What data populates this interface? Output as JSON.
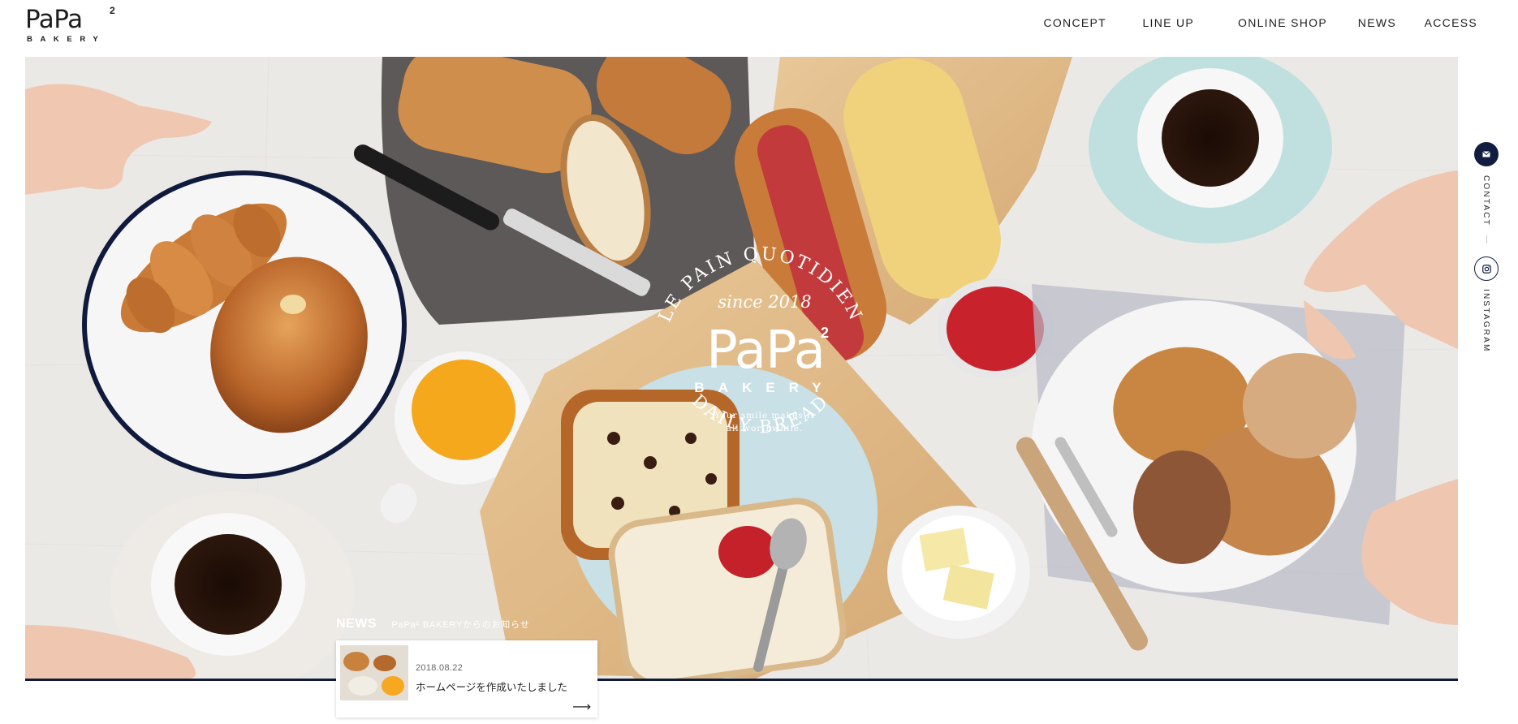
{
  "brand": {
    "logo_word": "PaPa",
    "logo_sup": "2",
    "logo_sub": "BAKERY"
  },
  "nav": {
    "items": [
      {
        "label": "CONCEPT"
      },
      {
        "label": "LINE UP"
      },
      {
        "label": "ONLINE SHOP"
      },
      {
        "label": "NEWS"
      },
      {
        "label": "ACCESS"
      }
    ]
  },
  "hero": {
    "arc_top": "LE PAIN QUOTIDIEN",
    "since": "since 2018",
    "papa": "PaPa",
    "papa_sup": "2",
    "bakery": "BAKERY",
    "tagline_1": "Your smile makes it",
    "tagline_2": "all worthwhile.",
    "arc_bottom": "DAILY BREAD"
  },
  "side": {
    "contact_label": "CONTACT",
    "instagram_label": "INSTAGRAM"
  },
  "news": {
    "heading": "NEWS",
    "subheading": "PaPa² BAKERYからのお知らせ",
    "items": [
      {
        "date": "2018.08.22",
        "title": "ホームページを作成いたしました"
      }
    ],
    "arrow": "⟶"
  },
  "colors": {
    "navy": "#101a3d",
    "tablecloth": "#eceae8",
    "text": "#1d1d1d"
  }
}
